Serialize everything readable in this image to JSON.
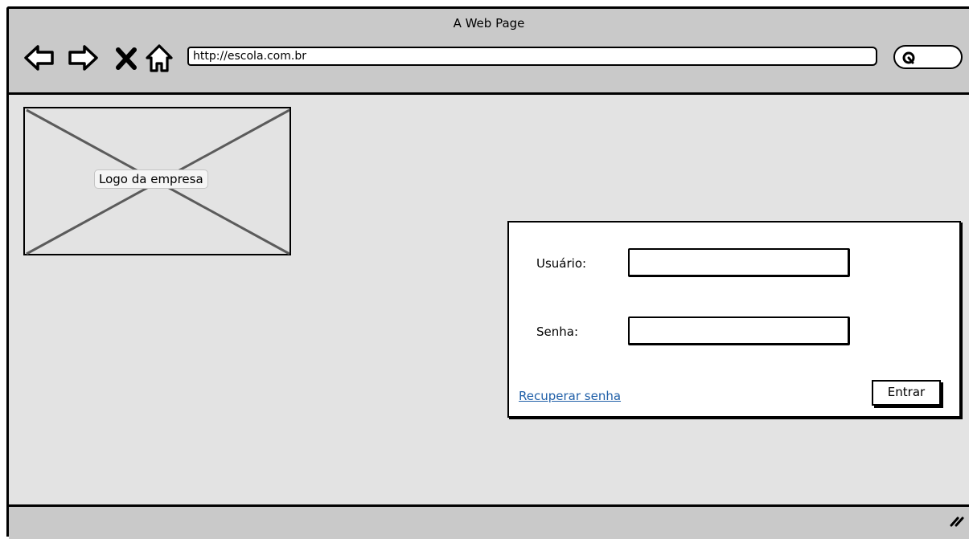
{
  "window": {
    "title": "A Web Page"
  },
  "toolbar": {
    "url": "http://escola.com.br",
    "icons": [
      "back-arrow-icon",
      "forward-arrow-icon",
      "close-x-icon",
      "home-icon",
      "search-icon"
    ]
  },
  "logo": {
    "label": "Logo da empresa"
  },
  "login": {
    "user_label": "Usuário:",
    "user_value": "",
    "password_label": "Senha:",
    "password_value": "",
    "recover_link": "Recuperar senha",
    "enter_button": "Entrar"
  },
  "colors": {
    "toolbar_bg": "#c9c9c9",
    "page_bg": "#e3e3e3",
    "link": "#1f5fa8"
  }
}
